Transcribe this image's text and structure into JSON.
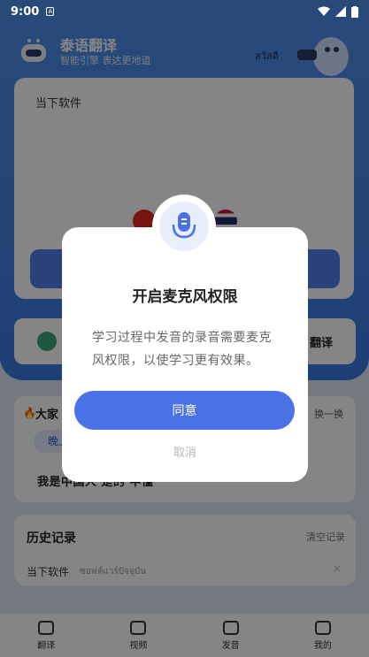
{
  "status_bar": {
    "time": "9:00",
    "sim_icon": "A"
  },
  "header": {
    "app_title": "泰语翻译",
    "app_subtitle": "智能引擎 表达更地道",
    "thai_greeting": "สวัสดี"
  },
  "input_card": {
    "text": "当下软件"
  },
  "mode_card": {
    "label": "翻译"
  },
  "popular": {
    "title": "大家",
    "refresh_label": "换一换",
    "chip": "晚上",
    "sentence": "我是中国人   是的   中懂"
  },
  "history": {
    "title": "历史记录",
    "clear_label": "清空记录",
    "item_zh": "当下软件",
    "item_th": "ซอฟต์แวร์ปัจจุบัน",
    "delete_glyph": "×"
  },
  "tabbar": {
    "tabs": [
      {
        "label": "翻译",
        "icon": "translate-icon"
      },
      {
        "label": "视频",
        "icon": "video-icon"
      },
      {
        "label": "发音",
        "icon": "pronounce-icon"
      },
      {
        "label": "我的",
        "icon": "profile-icon"
      }
    ]
  },
  "dialog": {
    "title": "开启麦克风权限",
    "message": "学习过程中发音的录音需要麦克风权限，以使学习更有效果。",
    "agree_label": "同意",
    "cancel_label": "取消",
    "icon": "microphone-icon",
    "accent_color": "#4a72e6"
  }
}
